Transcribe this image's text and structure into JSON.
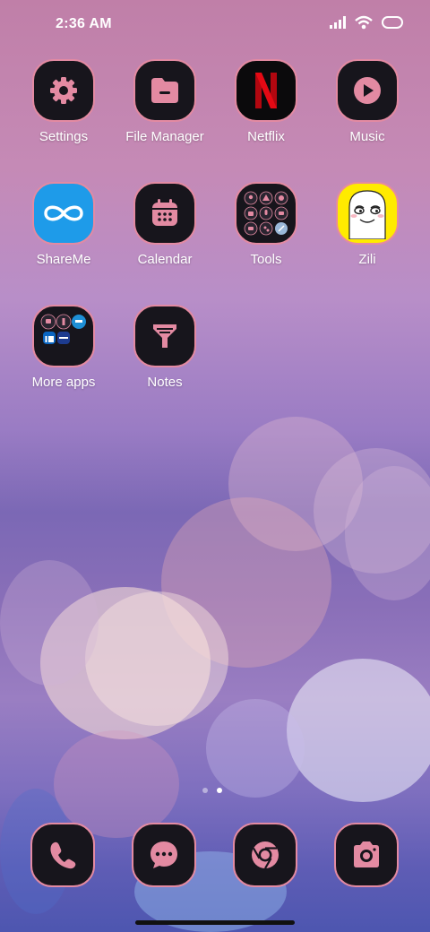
{
  "status_bar": {
    "time": "2:36 AM",
    "icons": [
      "signal-icon",
      "wifi-icon",
      "battery-icon"
    ]
  },
  "apps": [
    {
      "name": "settings",
      "label": "Settings",
      "icon": "gear-icon"
    },
    {
      "name": "file-manager",
      "label": "File Manager",
      "icon": "folder-icon"
    },
    {
      "name": "netflix",
      "label": "Netflix",
      "icon": "netflix-logo-icon"
    },
    {
      "name": "music",
      "label": "Music",
      "icon": "play-circle-icon"
    },
    {
      "name": "shareme",
      "label": "ShareMe",
      "icon": "infinity-icon"
    },
    {
      "name": "calendar",
      "label": "Calendar",
      "icon": "calendar-icon"
    },
    {
      "name": "tools",
      "label": "Tools",
      "icon": "tools-folder-icon"
    },
    {
      "name": "zili",
      "label": "Zili",
      "icon": "zili-face-icon"
    },
    {
      "name": "more-apps",
      "label": "More apps",
      "icon": "apps-folder-icon"
    },
    {
      "name": "notes",
      "label": "Notes",
      "icon": "notes-icon"
    }
  ],
  "page_indicator": {
    "count": 2,
    "active": 2
  },
  "dock": [
    {
      "name": "phone",
      "icon": "phone-icon"
    },
    {
      "name": "messages",
      "icon": "message-icon"
    },
    {
      "name": "chrome",
      "icon": "chrome-icon"
    },
    {
      "name": "camera",
      "icon": "camera-icon"
    }
  ],
  "colors": {
    "icon_bg": "#17151c",
    "icon_accent": "#e38aa2",
    "netflix_red": "#e50914",
    "shareme_blue": "#1e9be9",
    "zili_yellow": "#ffeb00"
  }
}
